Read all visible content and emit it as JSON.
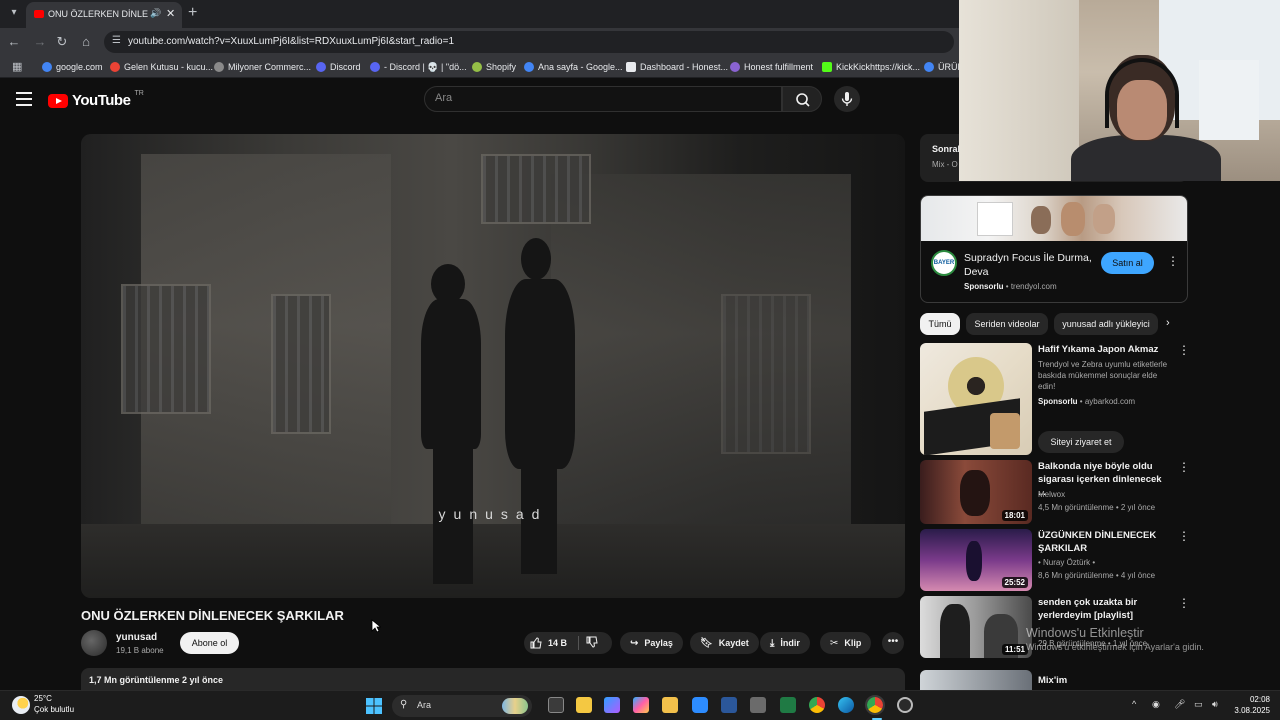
{
  "browser": {
    "tab_title": "ONU ÖZLERKEN DİNLENEC",
    "audio_icon": "speaker-icon",
    "url": "youtube.com/watch?v=XuuxLumPj6I&list=RDXuuxLumPj6I&start_radio=1",
    "bookmarks": [
      {
        "label": "google.com",
        "color": "#4285f4"
      },
      {
        "label": "Gelen Kutusu - kucu...",
        "color": "#ea4335"
      },
      {
        "label": "Milyoner Commerc...",
        "color": "#8a8a8a"
      },
      {
        "label": "Discord",
        "color": "#5865f2"
      },
      {
        "label": "- Discord | 💀 | \"dö...",
        "color": "#5865f2"
      },
      {
        "label": "Shopify",
        "color": "#95bf47"
      },
      {
        "label": "Ana sayfa - Google...",
        "color": "#4285f4"
      },
      {
        "label": "Dashboard - Honest...",
        "color": "#e8eaed"
      },
      {
        "label": "Honest fulfillment",
        "color": "#8a63d2"
      },
      {
        "label": "KickKickhttps://kick...",
        "color": "#53fc18"
      },
      {
        "label": "ÜRÜN",
        "color": "#4285f4"
      }
    ]
  },
  "masthead": {
    "logo_text": "YouTube",
    "region": "TR",
    "search_placeholder": "Ara"
  },
  "player": {
    "watermark": "yunusad"
  },
  "video": {
    "title": "ONU ÖZLERKEN DİNLENECEK ŞARKILAR",
    "channel": "yunusad",
    "subscribers": "19,1 B abone",
    "subscribe_label": "Abone ol",
    "likes": "14 B",
    "share_label": "Paylaş",
    "save_label": "Kaydet",
    "download_label": "İndir",
    "clip_label": "Klip",
    "meta": "1,7 Mn görüntülenme  2 yıl önce"
  },
  "playlist": {
    "title": "Sonrak",
    "subtitle": "Mix - O"
  },
  "ad": {
    "title": "Supradyn Focus İle Durma, Deva",
    "sponsored": "Sponsorlu",
    "domain": "trendyol.com",
    "cta": "Satın al",
    "logo_text": "BAYER"
  },
  "chips": [
    "Tümü",
    "Seriden videolar",
    "yunusad adlı yükleyici"
  ],
  "recommendations": [
    {
      "title": "Hafif Yıkama Japon Akmaz",
      "line1": "Trendyol ve Zebra uyumlu etiketlerle baskıda mükemmel sonuçlar elde edin!",
      "sponsored": "Sponsorlu",
      "domain": "aybarkod.com",
      "cta": "Siteyi ziyaret et"
    },
    {
      "title": "Balkonda niye böyle oldu sigarası içerken dinlenecek ...",
      "channel": "Melwox",
      "stats": "4,5 Mn görüntülenme • 2 yıl önce",
      "duration": "18:01"
    },
    {
      "title": "ÜZGÜNKEN DİNLENECEK ŞARKILAR",
      "channel": "• Nuray Öztürk •",
      "stats": "8,6 Mn görüntülenme • 4 yıl önce",
      "duration": "25:52"
    },
    {
      "title": "senden çok uzakta bir yerlerdeyim [playlist]",
      "channel": "",
      "stats": "29 B görüntülenme • 1 yıl önce",
      "duration": "11:51"
    },
    {
      "title": "Mix'im"
    }
  ],
  "watermark_os": {
    "line1": "Windows'u Etkinleştir",
    "line2": "Windows'u etkinleştirmek için Ayarlar'a gidin."
  },
  "taskbar": {
    "temp": "25°C",
    "weather": "Çok bulutlu",
    "search": "Ara",
    "time": "02:08",
    "date": "3.08.2025"
  }
}
